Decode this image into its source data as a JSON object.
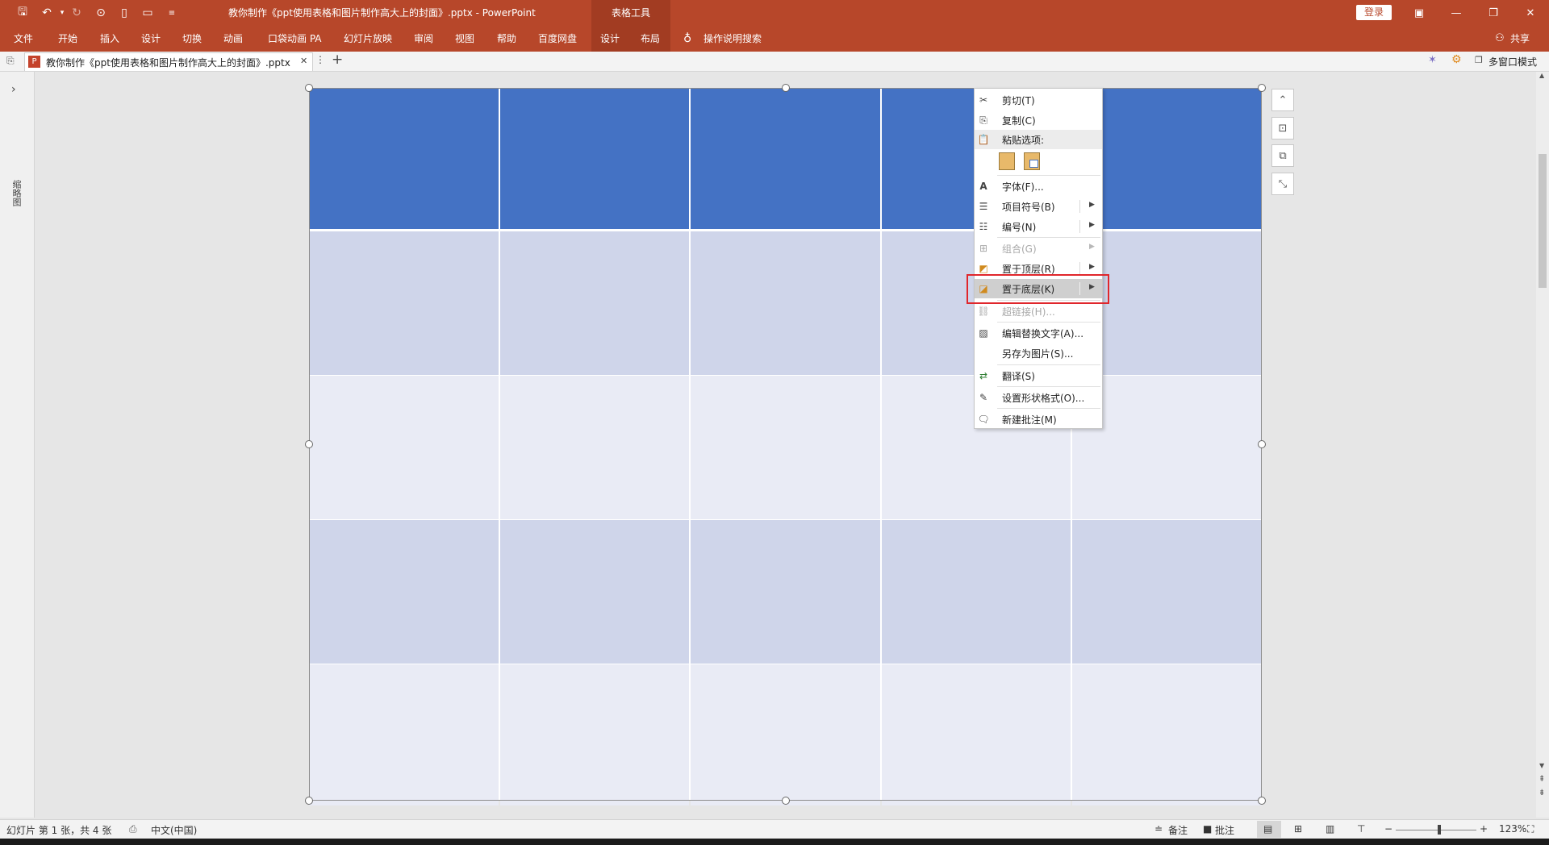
{
  "window": {
    "title": "教你制作《ppt使用表格和图片制作高大上的封面》.pptx  -  PowerPoint",
    "tools_tab": "表格工具",
    "login_label": "登录",
    "brand_color": "#b7472a"
  },
  "ribbon": {
    "tabs": [
      "文件",
      "开始",
      "插入",
      "设计",
      "切换",
      "动画",
      "口袋动画 PA",
      "幻灯片放映",
      "审阅",
      "视图",
      "帮助",
      "百度网盘",
      "设计",
      "布局"
    ],
    "search_label": "操作说明搜索",
    "share_label": "共享"
  },
  "tabbar": {
    "doc_tab_label": "教你制作《ppt使用表格和图片制作高大上的封面》.pptx",
    "close_glyph": "✕",
    "more_glyph": "⋮",
    "add_glyph": "+",
    "multiwindow_label": "多窗口模式"
  },
  "left_pane": {
    "label": "缩略图",
    "expand_glyph": "›"
  },
  "table": {
    "header_color": "#4472c4",
    "band_color": "#cfd5ea",
    "light_color": "#e9ebf5"
  },
  "context_menu": {
    "items": [
      {
        "label": "剪切(T)",
        "icon": "scissors-icon"
      },
      {
        "label": "复制(C)",
        "icon": "copy-icon"
      },
      {
        "label": "粘贴选项:",
        "icon": "paste-icon"
      },
      {
        "label": "字体(F)...",
        "icon": "font-icon"
      },
      {
        "label": "项目符号(B)",
        "icon": "bullets-icon"
      },
      {
        "label": "编号(N)",
        "icon": "numbering-icon"
      },
      {
        "label": "组合(G)",
        "icon": "group-icon"
      },
      {
        "label": "置于顶层(R)",
        "icon": "bring-to-front-icon"
      },
      {
        "label": "置于底层(K)",
        "icon": "send-to-back-icon"
      },
      {
        "label": "超链接(H)...",
        "icon": "hyperlink-icon"
      },
      {
        "label": "编辑替换文字(A)...",
        "icon": "alt-text-icon"
      },
      {
        "label": "另存为图片(S)...",
        "icon": "save-as-picture-icon"
      },
      {
        "label": "翻译(S)",
        "icon": "translate-icon"
      },
      {
        "label": "设置形状格式(O)...",
        "icon": "format-shape-icon"
      },
      {
        "label": "新建批注(M)",
        "icon": "new-comment-icon"
      }
    ],
    "highlight_color": "#e0262b"
  },
  "statusbar": {
    "slide_info": "幻灯片 第 1 张，共 4 张",
    "language": "中文(中国)",
    "notes_label": "备注",
    "comments_label": "批注",
    "zoom_label": "123%"
  }
}
